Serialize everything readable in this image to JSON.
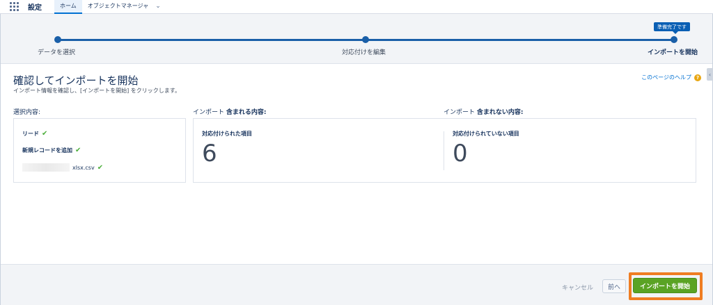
{
  "topbar": {
    "app_name": "設定",
    "tabs": [
      {
        "label": "ホーム"
      },
      {
        "label": "オブジェクトマネージャ"
      }
    ]
  },
  "stepper": {
    "badge": "準備完了です",
    "steps": [
      {
        "label": "データを選択"
      },
      {
        "label": "対応付けを編集"
      },
      {
        "label": "インポートを開始"
      }
    ]
  },
  "page": {
    "title": "確認してインポートを開始",
    "subtitle": "インポート情報を確認し、[インポートを開始] をクリックします。",
    "help_link": "このページのヘルプ",
    "help_icon_glyph": "?"
  },
  "columns": {
    "selected_header": "選択内容:",
    "included_prefix": "インポート",
    "included_bold": "含まれる内容:",
    "excluded_prefix": "インポート",
    "excluded_bold": "含まれない内容:"
  },
  "selection": {
    "items": [
      {
        "label": "リード"
      },
      {
        "label": "新規レコードを追加"
      },
      {
        "label": "xlsx.csv"
      }
    ]
  },
  "counts": {
    "mapped_label": "対応付けられた項目",
    "mapped_value": "6",
    "unmapped_label": "対応付けられていない項目",
    "unmapped_value": "0"
  },
  "footer": {
    "cancel": "キャンセル",
    "previous": "前へ",
    "start": "インポートを開始"
  },
  "colors": {
    "accent": "#1a5fa8",
    "start_button": "#5aa324",
    "highlight": "#ef7d22"
  }
}
